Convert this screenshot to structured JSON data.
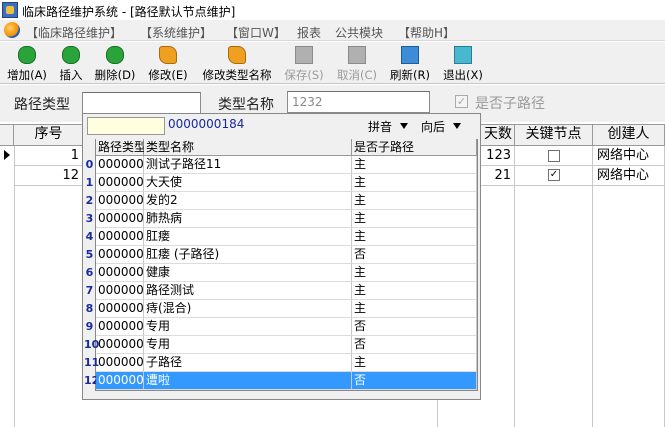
{
  "window": {
    "title": "临床路径维护系统 - [路径默认节点维护]"
  },
  "menu": [
    "【临床路径维护】",
    "【系统维护】",
    "【窗口W】",
    "报表",
    "公共模块",
    "【帮助H】"
  ],
  "toolbar": {
    "add": "增加(A)",
    "insert": "插入",
    "delete": "删除(D)",
    "edit": "修改(E)",
    "edit_type": "修改类型名称",
    "save": "保存(S)",
    "cancel": "取消(C)",
    "refresh": "刷新(R)",
    "exit": "退出(X)"
  },
  "filter": {
    "path_type_label": "路径类型",
    "path_type_value": "",
    "type_name_label": "类型名称",
    "type_name_value": "1232",
    "is_subpath_label": "是否子路径",
    "is_subpath_checked": true
  },
  "grid": {
    "headers": {
      "seq": "序号",
      "days": "天数",
      "key_node": "关键节点",
      "creator": "创建人"
    },
    "rows": [
      {
        "seq": "1",
        "days": "123",
        "key_node": false,
        "creator": "网络中心"
      },
      {
        "seq": "12",
        "days": "21",
        "key_node": true,
        "creator": "网络中心"
      }
    ]
  },
  "dropdown": {
    "search_value": "",
    "code": "0000000184",
    "pinyin": "拼音",
    "direction": "向后",
    "headers": {
      "type": "路径类型",
      "name": "类型名称",
      "subpath": "是否子路径"
    },
    "selected_index": 12,
    "rows": [
      {
        "num": "0",
        "type": "000000",
        "name": "测试子路径11",
        "subpath": "主"
      },
      {
        "num": "1",
        "type": "000000",
        "name": "大天使",
        "subpath": "主"
      },
      {
        "num": "2",
        "type": "000000",
        "name": "发的2",
        "subpath": "主"
      },
      {
        "num": "3",
        "type": "000000",
        "name": "肺热病",
        "subpath": "主"
      },
      {
        "num": "4",
        "type": "000000",
        "name": "肛瘘",
        "subpath": "主"
      },
      {
        "num": "5",
        "type": "000000",
        "name": "肛瘘 (子路径)",
        "subpath": "否"
      },
      {
        "num": "6",
        "type": "000000",
        "name": "健康",
        "subpath": "主"
      },
      {
        "num": "7",
        "type": "000000",
        "name": "路径测试",
        "subpath": "主"
      },
      {
        "num": "8",
        "type": "000000",
        "name": "痔(混合)",
        "subpath": "主"
      },
      {
        "num": "9",
        "type": "000000",
        "name": "专用",
        "subpath": "否"
      },
      {
        "num": "10",
        "type": "000000",
        "name": "专用",
        "subpath": "否"
      },
      {
        "num": "11",
        "type": "000000",
        "name": "子路径",
        "subpath": "主"
      },
      {
        "num": "12",
        "type": "000000",
        "name": "遭啦",
        "subpath": "否"
      }
    ]
  },
  "colors": {
    "selection": "#3399ff",
    "row_number": "#1a2a9a"
  }
}
